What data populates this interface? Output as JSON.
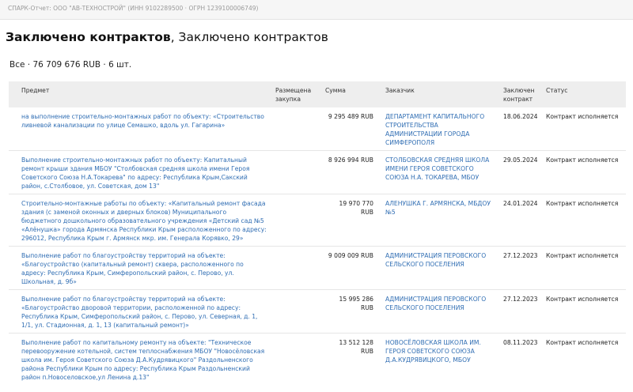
{
  "header": {
    "report_line": "СПАРК-Отчет: ООО \"АВ-ТЕХНОСТРОЙ\" (ИНН 9102289500 · ОГРН 1239100006749)"
  },
  "page": {
    "title_bold": "Заключено контрактов",
    "title_rest": ", Заключено контрактов",
    "summary": "Все · 76 709 676 RUB · 6 шт."
  },
  "table": {
    "columns": [
      "Предмет",
      "Размещена закупка",
      "Сумма",
      "Заказчик",
      "Заключен контракт",
      "Статус"
    ],
    "rows": [
      {
        "subject": "на выполнение строительно-монтажных работ по объекту: «Строительство ливневой канализации по улице Семашко, вдоль ул. Гагарина»",
        "placed": "",
        "amount": "9 295 489 RUB",
        "customer": "ДЕПАРТАМЕНТ КАПИТАЛЬНОГО СТРОИТЕЛЬСТВА АДМИНИСТРАЦИИ ГОРОДА СИМФЕРОПОЛЯ",
        "date": "18.06.2024",
        "status": "Контракт исполняется"
      },
      {
        "subject": "Выполнение строительно-монтажных работ по объекту: Капитальный ремонт крыши здания МБОУ \"Столбовская средняя школа имени Героя Советского Союза Н.А.Токарева\" по адресу: Республика Крым,Сакский район, с.Столбовое, ул. Советская, дом 13\"",
        "placed": "",
        "amount": "8 926 994 RUB",
        "customer": "СТОЛБОВСКАЯ СРЕДНЯЯ ШКОЛА ИМЕНИ ГЕРОЯ СОВЕТСКОГО СОЮЗА Н.А. ТОКАРЕВА, МБОУ",
        "date": "29.05.2024",
        "status": "Контракт исполняется"
      },
      {
        "subject": "Строительно-монтажные работы по объекту: «Капитальный ремонт фасада здания (с заменой оконных и дверных блоков) Муниципального бюджетного дошкольного образовательного учреждения «Детский сад №5 «Алёнушка» города Армянска Республики Крым расположенного по адресу: 296012, Республика Крым г. Армянск мкр. им. Генерала Корявко, 29»",
        "placed": "",
        "amount": "19 970 770 RUB",
        "customer": "АЛЕНУШКА Г. АРМЯНСКА, МБДОУ №5",
        "date": "24.01.2024",
        "status": "Контракт исполняется"
      },
      {
        "subject": "Выполнение работ по благоустройству территорий на объекте: «Благоустройство (капитальный ремонт) сквера, расположенного по адресу: Республика Крым, Симферопольский район, с. Перово, ул. Школьная, д. 9б»",
        "placed": "",
        "amount": "9 009 009 RUB",
        "customer": "АДМИНИСТРАЦИЯ ПЕРОВСКОГО СЕЛЬСКОГО ПОСЕЛЕНИЯ",
        "date": "27.12.2023",
        "status": "Контракт исполняется"
      },
      {
        "subject": "Выполнение работ по благоустройству территорий на объекте: «Благоустройство дворовой территории, расположенной по адресу: Республика Крым, Симферопольский район, с. Перово, ул. Северная, д. 1, 1/1, ул. Стадионная, д. 1, 13 (капитальный ремонт)»",
        "placed": "",
        "amount": "15 995 286 RUB",
        "customer": "АДМИНИСТРАЦИЯ ПЕРОВСКОГО СЕЛЬСКОГО ПОСЕЛЕНИЯ",
        "date": "27.12.2023",
        "status": "Контракт исполняется"
      },
      {
        "subject": "Выполнение работ по капитальному ремонту на объекте: \"Техническое перевооружение котельной, систем теплоснабжения МБОУ \"Новосёловская школа им. Героя Советского Союза Д.А.Кудрявицкого\" Раздольненского района Республики Крым по адресу: Республика Крым Раздольненский район п.Новоселовское,ул Ленина д.13\"",
        "placed": "",
        "amount": "13 512 128 RUB",
        "customer": "НОВОСЁЛОВСКАЯ ШКОЛА ИМ. ГЕРОЯ СОВЕТСКОГО СОЮЗА Д.А.КУДРЯВИЦКОГО, МБОУ",
        "date": "08.11.2023",
        "status": "Контракт исполняется"
      }
    ]
  }
}
